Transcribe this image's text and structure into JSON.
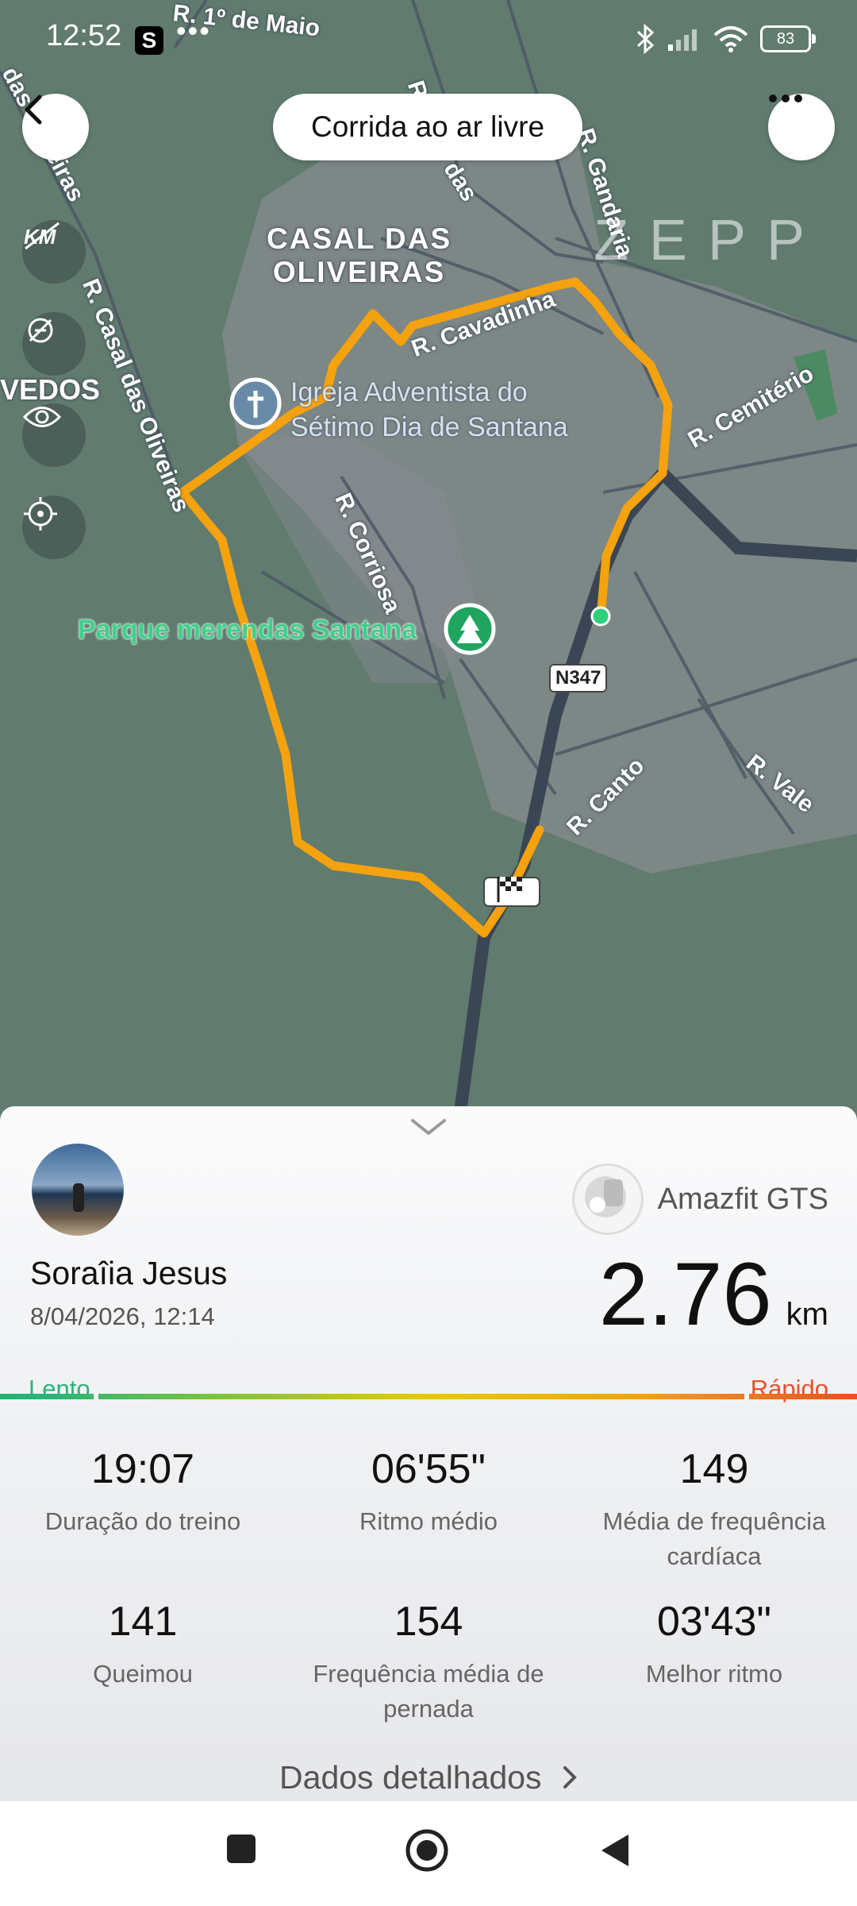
{
  "status_bar": {
    "time": "12:52",
    "notification_badge": "S",
    "more_dots": "•••",
    "battery": "83"
  },
  "header": {
    "title": "Corrida ao ar livre",
    "brand": "ZEPP"
  },
  "map": {
    "area_label_line1": "CASAL DAS",
    "area_label_line2": "OLIVEIRAS",
    "partial_area_label": "VEDOS",
    "streets": {
      "r1": "R. 1º de Maio",
      "r_casal_oliveiras": "R. Casal das Oliveiras",
      "r_oliveiras_top": "das Oliveiras",
      "r_cavadinha": "R. Cavadinha",
      "r_gandaria": "R. Gandaria",
      "r_cemiterio": "R. Cemitério",
      "r_corriosa": "R. Corriosa",
      "r_canto": "R. Canto",
      "r_vale": "R. Vale",
      "r_das": "das",
      "r_top": "R."
    },
    "church": "Igreja Adventista do Sétimo Dia de Santana",
    "church_line1": "Igreja Adventista do",
    "church_line2": "Sétimo Dia de Santana",
    "park": "Parque merendas Santana",
    "road_badge": "N347",
    "tools": [
      "km-toggle-icon",
      "hide-route-icon",
      "eye-icon",
      "locate-icon"
    ]
  },
  "summary": {
    "user_name": "Soraîia Jesus",
    "date": "8/04/2026, 12:14",
    "device": "Amazfit GTS",
    "distance_value": "2.76",
    "distance_unit": "km",
    "pace_slow": "Lento",
    "pace_fast": "Rápido"
  },
  "stats": [
    {
      "value": "19:07",
      "label": "Duração do treino"
    },
    {
      "value": "06'55\"",
      "label": "Ritmo médio"
    },
    {
      "value": "149",
      "label": "Média de frequência cardíaca"
    },
    {
      "value": "141",
      "label": "Queimou"
    },
    {
      "value": "154",
      "label": "Frequência média de pernada"
    },
    {
      "value": "03'43\"",
      "label": "Melhor ritmo"
    }
  ],
  "details_link": "Dados detalhados",
  "colors": {
    "route": "#f5a20f",
    "map_bg": "#617b6f",
    "slow": "#2bb37a",
    "fast": "#e8512c"
  }
}
